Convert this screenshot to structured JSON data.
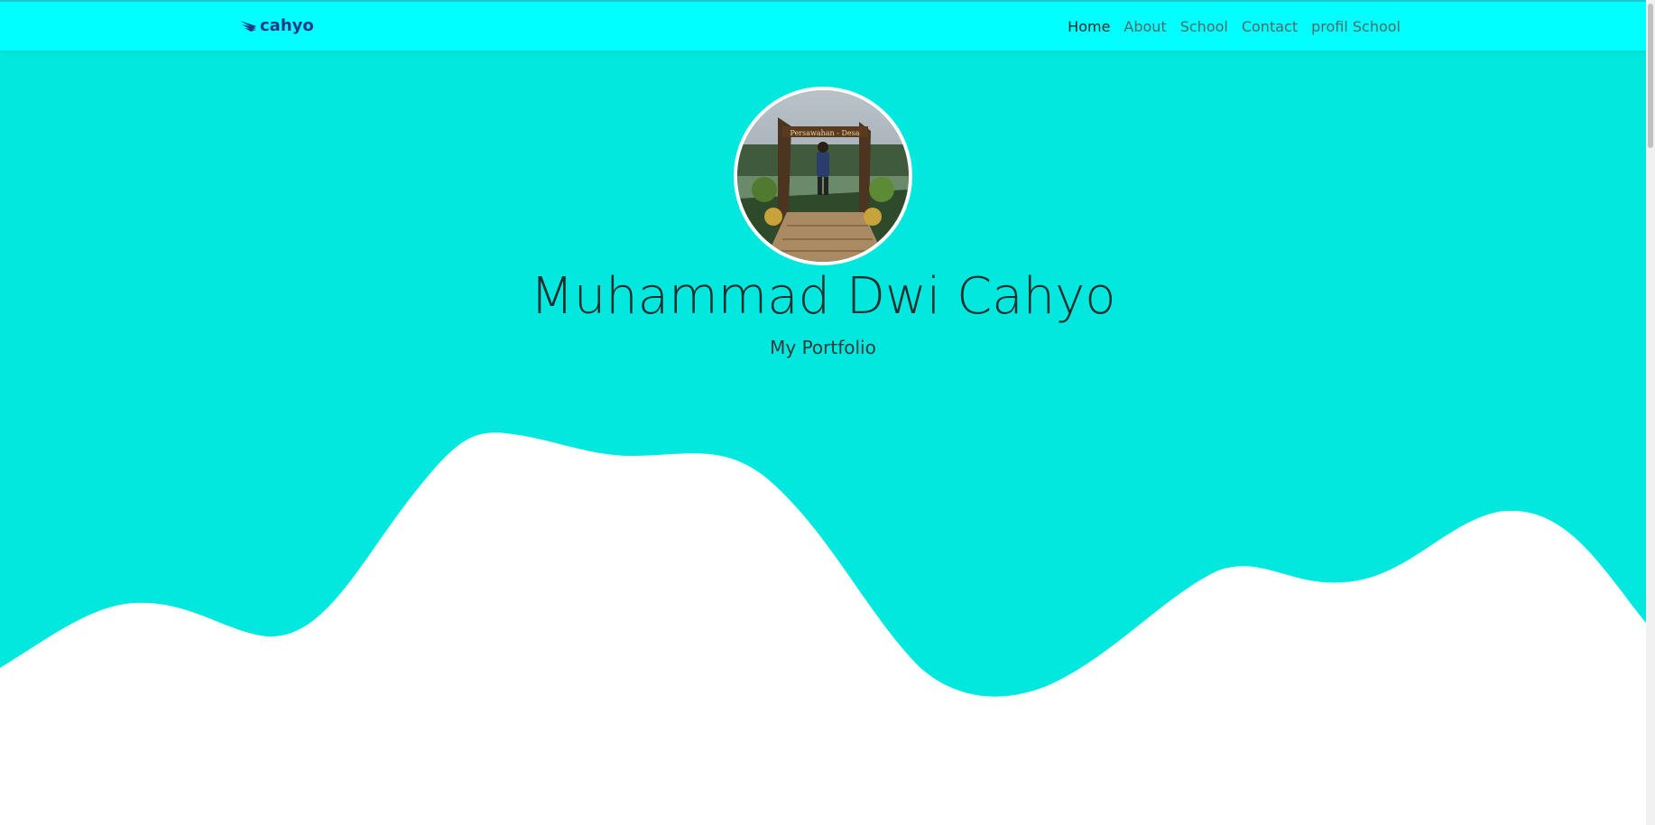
{
  "navbar": {
    "brand": "cahyo",
    "links": [
      {
        "label": "Home",
        "active": true
      },
      {
        "label": "About",
        "active": false
      },
      {
        "label": "School",
        "active": false
      },
      {
        "label": "Contact",
        "active": false
      },
      {
        "label": "profil School",
        "active": false
      }
    ]
  },
  "hero": {
    "title": "Muhammad Dwi Cahyo",
    "subtitle": "My Portfolio",
    "avatar_sign": "Persawahan - Desa"
  },
  "colors": {
    "navbar_bg": "#00ffff",
    "hero_bg": "#03e8de",
    "brand": "#1f3a8a",
    "wave": "#ffffff"
  },
  "icons": {
    "brand_logo": "wing-icon"
  }
}
